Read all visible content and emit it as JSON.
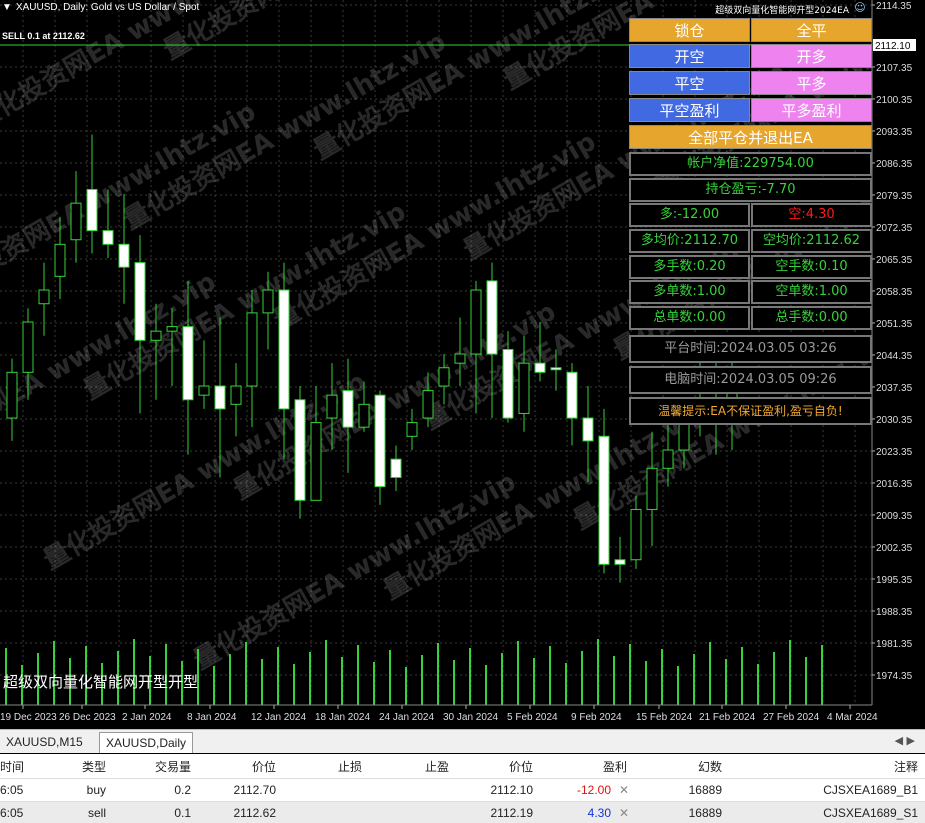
{
  "chart": {
    "title": "XAUUSD, Daily:  Gold vs US Dollar / Spot",
    "sell_line_label": "SELL 0.1 at 2112.62",
    "ea_name_top": "超级双向量化智能网开型2024EA",
    "ea_comment": "超级双向量化智能网开型开型",
    "price_labels": [
      "2114.35",
      "2112.10",
      "2107.35",
      "2100.35",
      "2093.35",
      "2086.35",
      "2079.35",
      "2072.35",
      "2065.35",
      "2058.35",
      "2051.35",
      "2044.35",
      "2037.35",
      "2030.35",
      "2023.35",
      "2016.35",
      "2009.35",
      "2002.35",
      "1995.35",
      "1988.35",
      "1981.35",
      "1974.35"
    ],
    "current_price_label": "2112.10",
    "date_labels": [
      "19 Dec 2023",
      "26 Dec 2023",
      "2 Jan 2024",
      "8 Jan 2024",
      "12 Jan 2024",
      "18 Jan 2024",
      "24 Jan 2024",
      "30 Jan 2024",
      "5 Feb 2024",
      "9 Feb 2024",
      "15 Feb 2024",
      "21 Feb 2024",
      "27 Feb 2024",
      "4 Mar 2024"
    ],
    "watermark": "量化投资网EA  www.lhtz.vip",
    "colors": {
      "bull": "#000000",
      "bear": "#ffffff",
      "wick": "#37d23a",
      "grid": "#3a3a3a",
      "volume": "#37d23a",
      "sell_line": "#37d23a"
    }
  },
  "panel": {
    "btn_lock": "锁仓",
    "btn_close_all": "全平",
    "btn_open_short": "开空",
    "btn_open_long": "开多",
    "btn_close_short": "平空",
    "btn_close_long": "平多",
    "btn_close_short_profit": "平空盈利",
    "btn_close_long_profit": "平多盈利",
    "btn_close_all_exit": "全部平仓并退出EA",
    "equity": "帐户净值:229754.00",
    "position_pl": "持仓盈亏:-7.70",
    "long_pl": "多:-12.00",
    "short_pl": "空:4.30",
    "long_avg": "多均价:2112.70",
    "short_avg": "空均价:2112.62",
    "long_lots": "多手数:0.20",
    "short_lots": "空手数:0.10",
    "long_orders": "多单数:1.00",
    "short_orders": "空单数:1.00",
    "total_orders": "总单数:0.00",
    "total_lots": "总手数:0.00",
    "platform_time": "平台时间:2024.03.05 03:26",
    "pc_time": "电脑时间:2024.03.05 09:26",
    "tip": "温馨提示:EA不保证盈利,盈亏自负!"
  },
  "tabs": {
    "items": [
      "XAUUSD,M15",
      "XAUUSD,Daily"
    ],
    "active": "XAUUSD,Daily"
  },
  "orders": {
    "headers": {
      "time": "时间",
      "type": "类型",
      "volume": "交易量",
      "price": "价位",
      "sl": "止损",
      "tp": "止盈",
      "cur_price": "价位",
      "profit": "盈利",
      "magic": "幻数",
      "comment": "注释"
    },
    "rows": [
      {
        "time": "6:05",
        "type": "buy",
        "volume": "0.2",
        "price": "2112.70",
        "sl": "",
        "tp": "",
        "cur_price": "2112.10",
        "profit": "-12.00",
        "magic": "16889",
        "comment": "CJSXEA1689_B1"
      },
      {
        "time": "6:05",
        "type": "sell",
        "volume": "0.1",
        "price": "2112.62",
        "sl": "",
        "tp": "",
        "cur_price": "2112.19",
        "profit": "4.30",
        "magic": "16889",
        "comment": "CJSXEA1689_S1"
      }
    ]
  }
}
